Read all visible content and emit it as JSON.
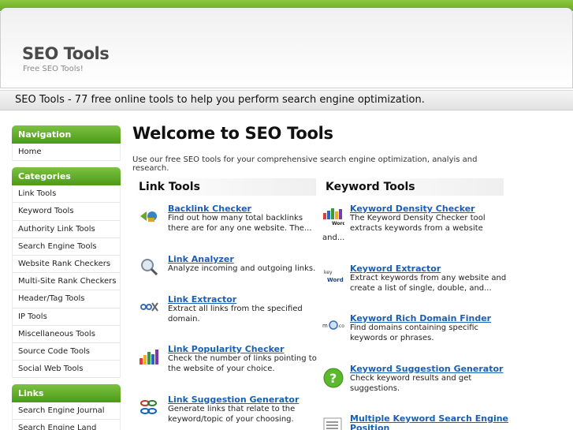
{
  "header": {
    "title": "SEO Tools",
    "tagline": "Free SEO Tools!"
  },
  "banner": "SEO Tools - 77 free online tools to help you perform search engine optimization.",
  "sidebar": {
    "navigation": {
      "heading": "Navigation",
      "items": [
        "Home"
      ]
    },
    "categories": {
      "heading": "Categories",
      "items": [
        "Link Tools",
        "Keyword Tools",
        "Authority Link Tools",
        "Search Engine Tools",
        "Website Rank Checkers",
        "Multi-Site Rank Checkers",
        "Header/Tag Tools",
        "IP Tools",
        "Miscellaneous Tools",
        "Source Code Tools",
        "Social Web Tools"
      ]
    },
    "links": {
      "heading": "Links",
      "items": [
        "Search Engine Journal",
        "Search Engine Land"
      ]
    }
  },
  "main": {
    "title": "Welcome to SEO Tools",
    "intro": "Use our free SEO tools for your comprehensive search engine optimization, analyis and research.",
    "link_tools": {
      "heading": "Link Tools",
      "items": [
        {
          "title": "Backlink Checker",
          "desc": "Find out how many total backlinks there are for any one website. The...",
          "icon": "backlink-icon"
        },
        {
          "title": "Link Analyzer",
          "desc": "Analyze incoming and outgoing links.",
          "icon": "magnifier-icon"
        },
        {
          "title": "Link Extractor",
          "desc": "Extract all links from the specified domain.",
          "icon": "scissors-chain-icon"
        },
        {
          "title": "Link Popularity Checker",
          "desc": "Check the number of links pointing to the website of your choice.",
          "icon": "bar-chart-icon"
        },
        {
          "title": "Link Suggestion Generator",
          "desc": "Generate links that relate to the keyword/topic of your choosing.",
          "icon": "chain-links-icon"
        }
      ]
    },
    "keyword_tools": {
      "heading": "Keyword Tools",
      "items": [
        {
          "title": "Keyword Density Checker",
          "desc": "The Keyword Density Checker tool extracts keywords from a website",
          "desc_tail": "and...",
          "icon": "keyword-density-icon"
        },
        {
          "title": "Keyword Extractor",
          "desc": "Extract keywords from any website and create a list of single, double, and...",
          "icon": "keyword-extractor-icon"
        },
        {
          "title": "Keyword Rich Domain Finder",
          "desc": "Find domains containing specific keywords or phrases.",
          "icon": "domain-finder-icon"
        },
        {
          "title": "Keyword Suggestion Generator",
          "desc": "Check keyword results and get suggestions.",
          "icon": "help-icon"
        },
        {
          "title": "Multiple Keyword Search Engine",
          "title_line2": "Position",
          "icon": "multi-keyword-icon"
        }
      ]
    }
  },
  "colors": {
    "green_top": "#8cc63f",
    "green_head": "#4c9a17",
    "link_blue": "#1a5fb4"
  }
}
